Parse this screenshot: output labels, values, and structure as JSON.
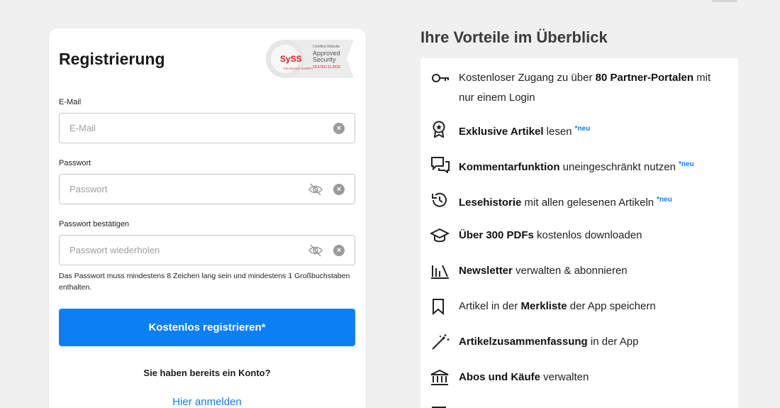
{
  "registration": {
    "title": "Registrierung",
    "seal": {
      "line1": "Certified Website",
      "line2": "Approved",
      "line3": "Security",
      "line4": "TESTED 11.2023",
      "brand": "SySS",
      "tagline": "THE PENTEST EXPERTS"
    },
    "email": {
      "label": "E-Mail",
      "placeholder": "E-Mail",
      "value": ""
    },
    "password": {
      "label": "Passwort",
      "placeholder": "Passwort",
      "value": ""
    },
    "password_confirm": {
      "label": "Passwort bestätigen",
      "placeholder": "Passwort wiederholen",
      "value": ""
    },
    "hint": "Das Passwort muss mindestens 8 Zeichen lang sein und mindestens 1 Großbuchstaben enthalten.",
    "submit_label": "Kostenlos registrieren*",
    "account_question": "Sie haben bereits ein Konto?",
    "login_link": "Hier anmelden"
  },
  "benefits": {
    "title": "Ihre Vorteile im Überblick",
    "neu_label": "*neu",
    "items": [
      {
        "icon": "key-icon",
        "pre": "Kostenloser Zugang zu über ",
        "bold": "80 Partner-Portalen",
        "post": " mit nur einem Login",
        "neu": false
      },
      {
        "icon": "award-badge-icon",
        "pre": "",
        "bold": "Exklusive Artikel",
        "post": " lesen",
        "neu": true
      },
      {
        "icon": "comments-icon",
        "pre": "",
        "bold": "Kommentarfunktion",
        "post": " uneingeschränkt nutzen",
        "neu": true
      },
      {
        "icon": "history-icon",
        "pre": "",
        "bold": "Lesehistorie",
        "post": " mit allen gelesenen Artikeln",
        "neu": true
      },
      {
        "icon": "graduation-cap-icon",
        "pre": "",
        "bold": "Über 300 PDFs",
        "post": " kostenlos downloaden",
        "neu": false
      },
      {
        "icon": "newsletter-bars-icon",
        "pre": "",
        "bold": "Newsletter",
        "post": " verwalten & abonnieren",
        "neu": false
      },
      {
        "icon": "bookmark-icon",
        "pre": "Artikel in der ",
        "bold": "Merkliste",
        "post": " der App speichern",
        "neu": false
      },
      {
        "icon": "magic-wand-icon",
        "pre": "",
        "bold": "Artikelzusammenfassung",
        "post": " in der App",
        "neu": false
      },
      {
        "icon": "bank-icon",
        "pre": "",
        "bold": "Abos und Käufe",
        "post": " verwalten",
        "neu": false
      }
    ]
  },
  "colors": {
    "accent": "#0b80f4",
    "background": "#f0f0f0",
    "card": "#ffffff"
  }
}
